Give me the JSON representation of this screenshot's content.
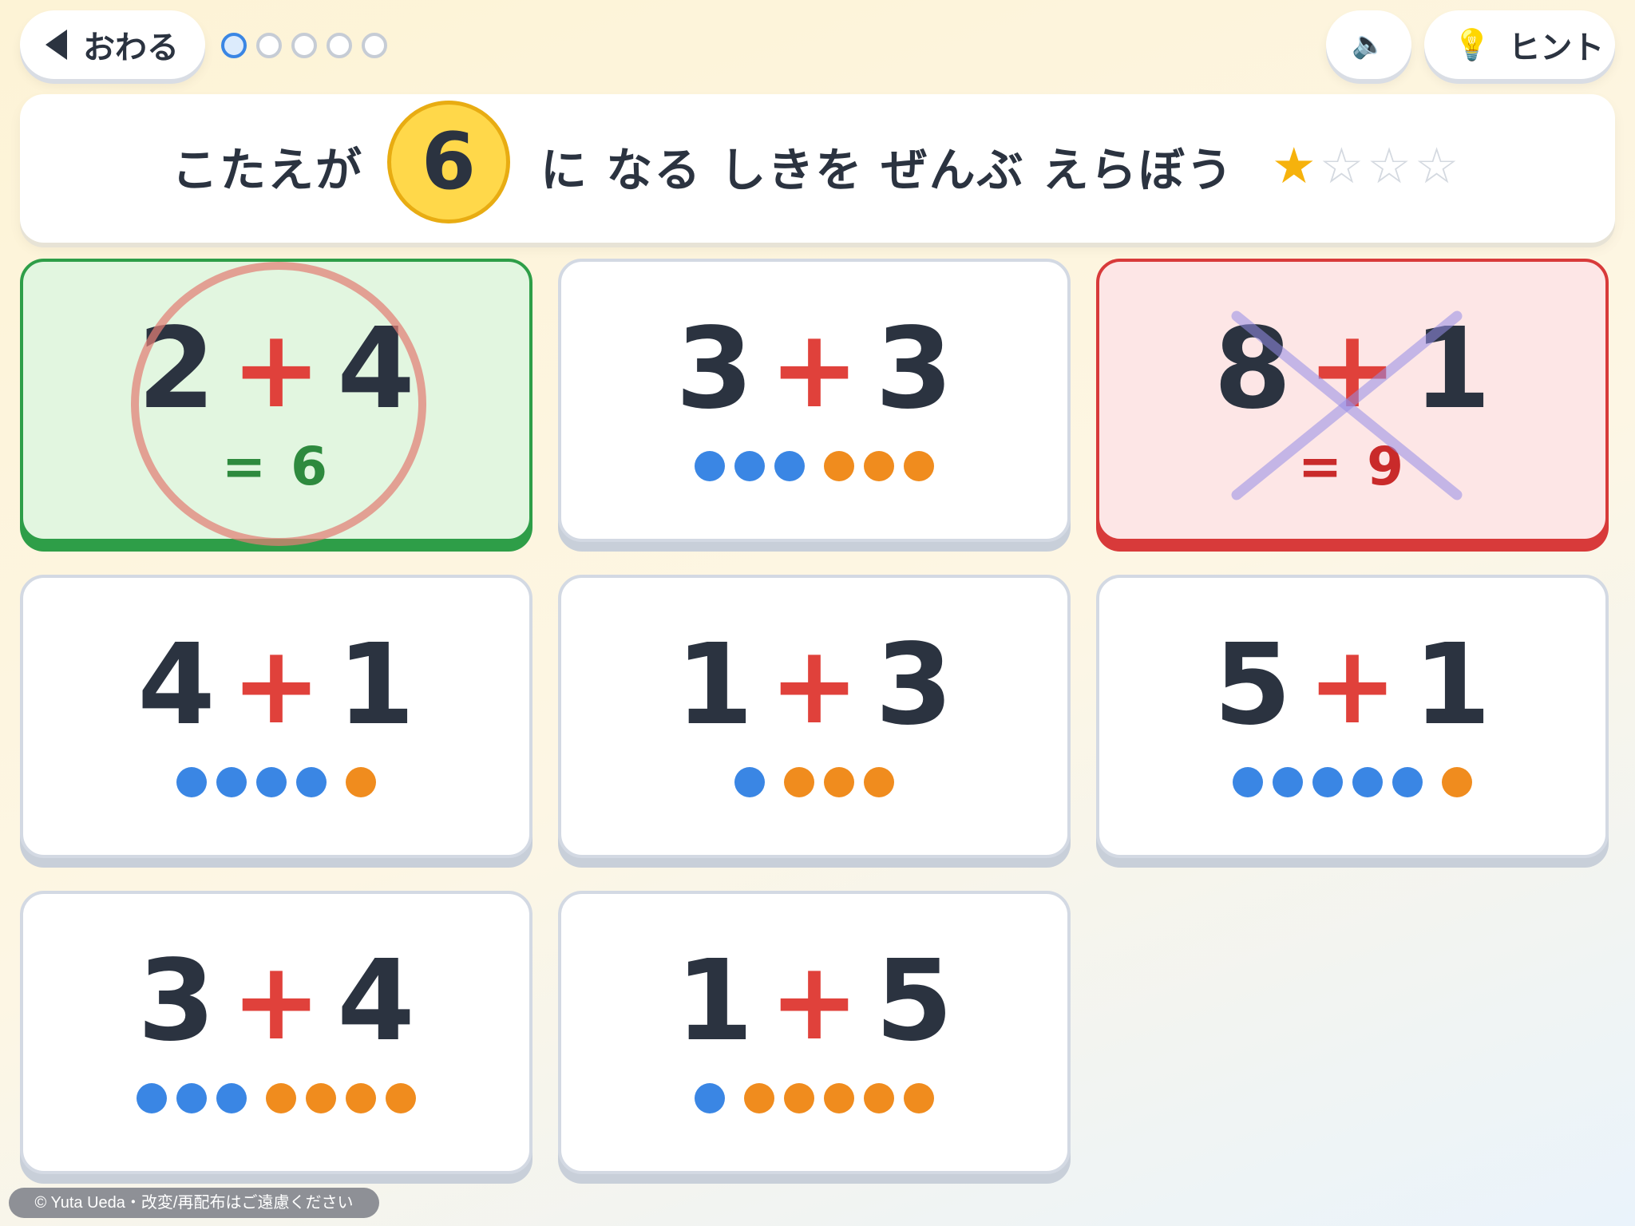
{
  "header": {
    "back_label": "おわる",
    "progress_total": 5,
    "progress_current": 1,
    "sound_icon": "speaker-icon",
    "hint_icon": "lightbulb-icon",
    "hint_label": "ヒント"
  },
  "question": {
    "prefix": "こたえが",
    "target": "6",
    "suffix": "に なる しきを ぜんぶ えらぼう",
    "stars_earned": 1,
    "stars_total": 4
  },
  "cards": [
    {
      "a": "2",
      "op": "+",
      "b": "4",
      "state": "correct",
      "result": "= 6",
      "mark": "circle"
    },
    {
      "a": "3",
      "op": "+",
      "b": "3",
      "state": "unselected",
      "blue_dots": 3,
      "orange_dots": 3
    },
    {
      "a": "8",
      "op": "+",
      "b": "1",
      "state": "wrong",
      "result": "= 9",
      "mark": "cross"
    },
    {
      "a": "4",
      "op": "+",
      "b": "1",
      "state": "unselected",
      "blue_dots": 4,
      "orange_dots": 1
    },
    {
      "a": "1",
      "op": "+",
      "b": "3",
      "state": "unselected",
      "blue_dots": 1,
      "orange_dots": 3
    },
    {
      "a": "5",
      "op": "+",
      "b": "1",
      "state": "unselected",
      "blue_dots": 5,
      "orange_dots": 1
    },
    {
      "a": "3",
      "op": "+",
      "b": "4",
      "state": "unselected",
      "blue_dots": 3,
      "orange_dots": 4
    },
    {
      "a": "1",
      "op": "+",
      "b": "5",
      "state": "unselected",
      "blue_dots": 1,
      "orange_dots": 5
    }
  ],
  "colors": {
    "blue_counter": "#3a86e4",
    "orange_counter": "#f08c1e",
    "operator": "#e0413b",
    "correct_border": "#2e9e48",
    "wrong_border": "#d83a3a",
    "target_fill": "#ffd84a"
  },
  "credit": "© Yuta Ueda・改変/再配布はご遠慮ください"
}
